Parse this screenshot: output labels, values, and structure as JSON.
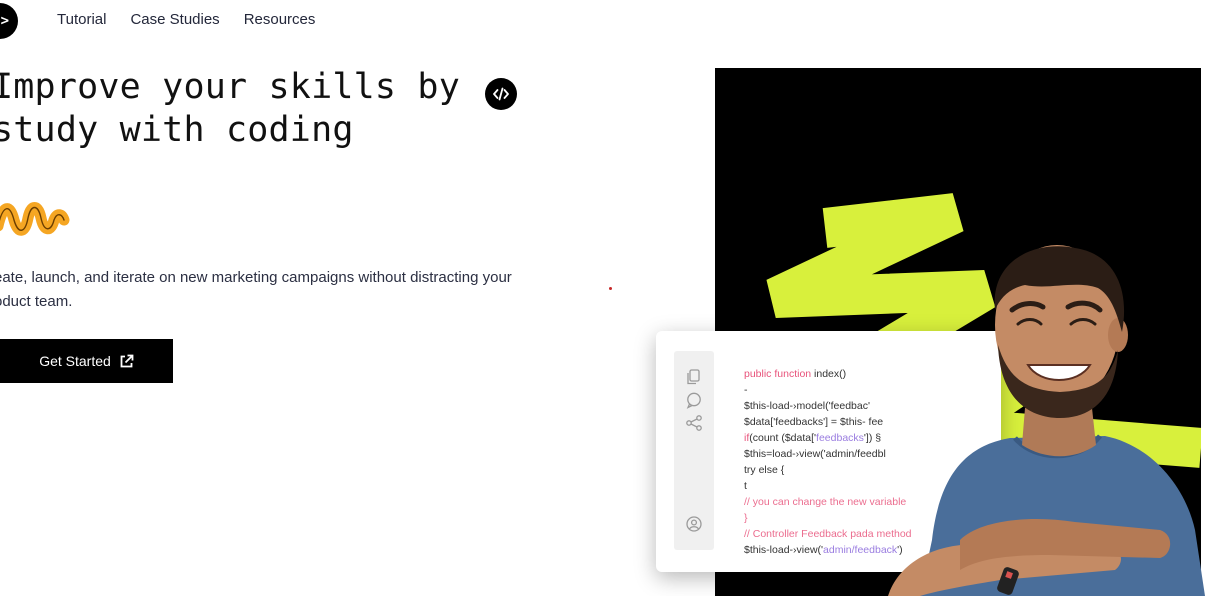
{
  "logo": {
    "glyph": ">"
  },
  "nav": {
    "items": [
      {
        "label": "Tutorial"
      },
      {
        "label": "Case Studies"
      },
      {
        "label": "Resources"
      }
    ]
  },
  "hero": {
    "headline_line1": "Improve your skills by",
    "headline_line2": "study with coding",
    "description_line1": "eate, launch, and iterate on new marketing campaigns without distracting your",
    "description_line2": "oduct team.",
    "cta_label": "Get Started"
  },
  "code_card": {
    "lines": [
      [
        {
          "t": "public function ",
          "c": "kw"
        },
        {
          "t": "index()",
          "c": ""
        }
      ],
      [
        {
          "t": "-",
          "c": ""
        }
      ],
      [
        {
          "t": "$this-load-›model('feedbac'",
          "c": ""
        }
      ],
      [
        {
          "t": "$data['feedbacks'] = $this- fee",
          "c": ""
        }
      ],
      [
        {
          "t": "if",
          "c": "kw"
        },
        {
          "t": "(count ($data['",
          "c": ""
        },
        {
          "t": "feedbacks",
          "c": "str"
        },
        {
          "t": "']) §",
          "c": ""
        }
      ],
      [
        {
          "t": "$this=load-›view('admin/feedbl",
          "c": ""
        }
      ],
      [
        {
          "t": "try else {",
          "c": ""
        }
      ],
      [
        {
          "t": "t",
          "c": ""
        }
      ],
      [
        {
          "t": "// you can change the new variable",
          "c": "cm"
        }
      ],
      [
        {
          "t": "}",
          "c": "cm"
        }
      ],
      [
        {
          "t": "// Controller Feedback pada method",
          "c": "cm"
        }
      ],
      [
        {
          "t": "$this-load-›view('",
          "c": ""
        },
        {
          "t": "admin/feedback",
          "c": "str"
        },
        {
          "t": "')",
          "c": ""
        }
      ]
    ]
  },
  "colors": {
    "accent_lime": "#d8f03c",
    "accent_orange": "#f5a623",
    "hero_bg": "#000000",
    "shirt": "#4a6e9a"
  },
  "icons": [
    "code-icon",
    "external-link-icon",
    "copy-icon",
    "comment-icon",
    "share-icon",
    "user-icon",
    "squiggle-decoration"
  ]
}
